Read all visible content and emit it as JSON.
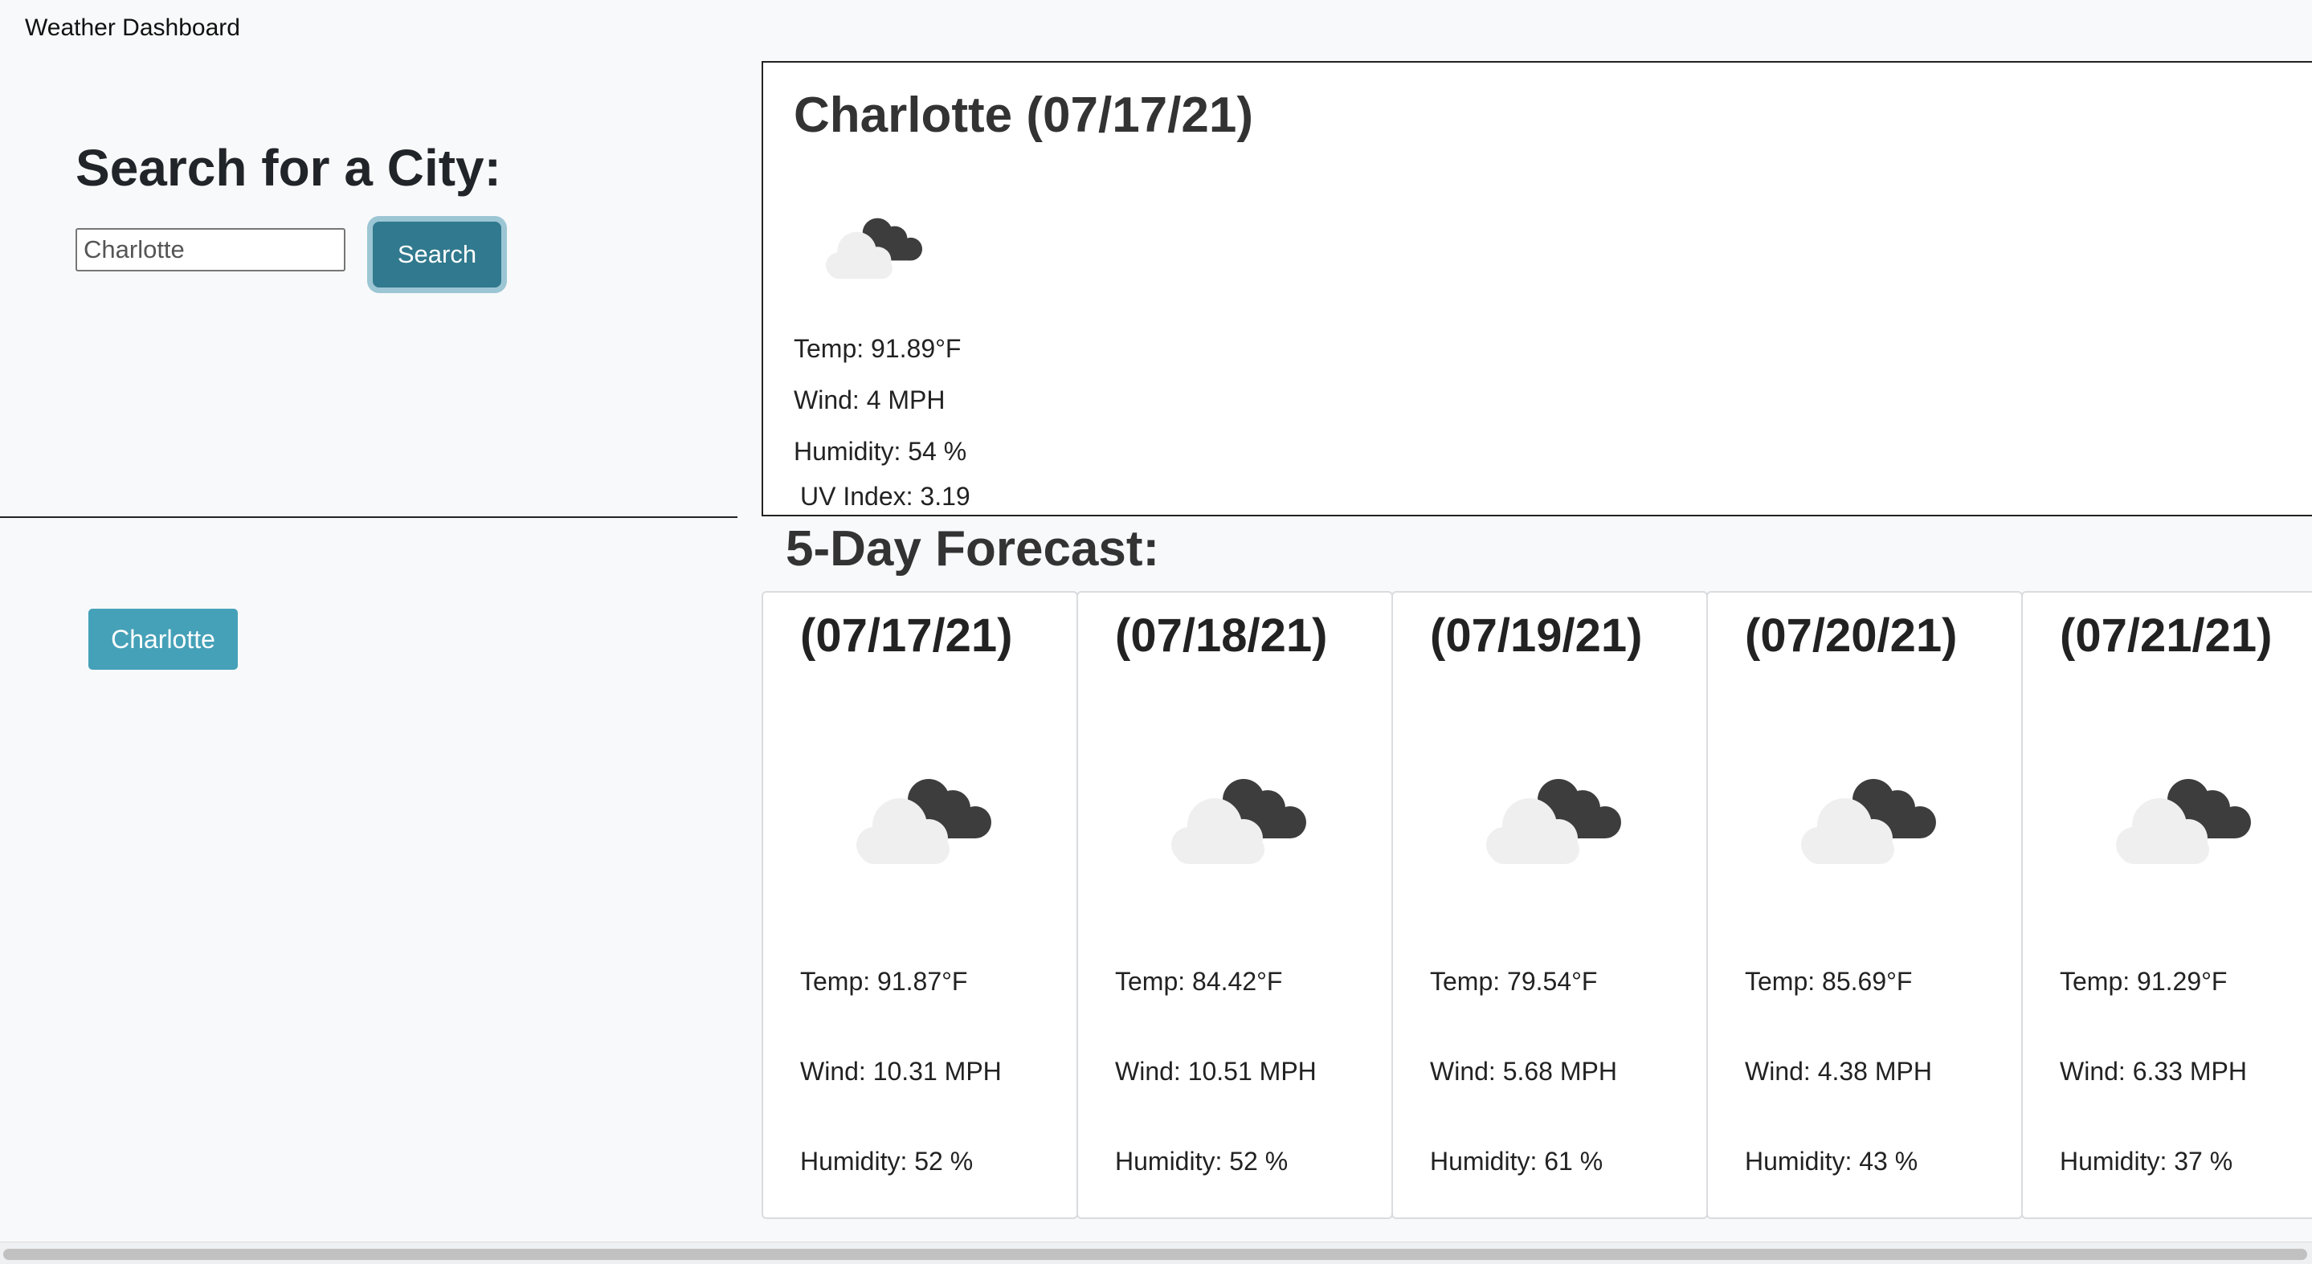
{
  "app": {
    "title": "Weather Dashboard"
  },
  "search": {
    "heading": "Search for a City:",
    "input_value": "Charlotte",
    "button_label": "Search",
    "accent_color": "#31798e"
  },
  "history": {
    "items": [
      {
        "label": "Charlotte"
      }
    ],
    "button_color": "#45a1b8"
  },
  "current": {
    "title": "Charlotte (07/17/21)",
    "icon": "broken-clouds-icon",
    "temp": "Temp: 91.89°F",
    "wind": "Wind: 4 MPH",
    "humidity": "Humidity: 54 %",
    "uv": "UV Index: 3.19"
  },
  "forecast": {
    "heading": "5-Day Forecast:",
    "days": [
      {
        "date": "(07/17/21)",
        "icon": "broken-clouds-icon",
        "temp": "Temp: 91.87°F",
        "wind": "Wind: 10.31 MPH",
        "humidity": "Humidity: 52 %"
      },
      {
        "date": "(07/18/21)",
        "icon": "broken-clouds-icon",
        "temp": "Temp: 84.42°F",
        "wind": "Wind: 10.51 MPH",
        "humidity": "Humidity: 52 %"
      },
      {
        "date": "(07/19/21)",
        "icon": "broken-clouds-icon",
        "temp": "Temp: 79.54°F",
        "wind": "Wind: 5.68 MPH",
        "humidity": "Humidity: 61 %"
      },
      {
        "date": "(07/20/21)",
        "icon": "broken-clouds-icon",
        "temp": "Temp: 85.69°F",
        "wind": "Wind: 4.38 MPH",
        "humidity": "Humidity: 43 %"
      },
      {
        "date": "(07/21/21)",
        "icon": "broken-clouds-icon",
        "temp": "Temp: 91.29°F",
        "wind": "Wind: 6.33 MPH",
        "humidity": "Humidity: 37 %"
      }
    ]
  }
}
